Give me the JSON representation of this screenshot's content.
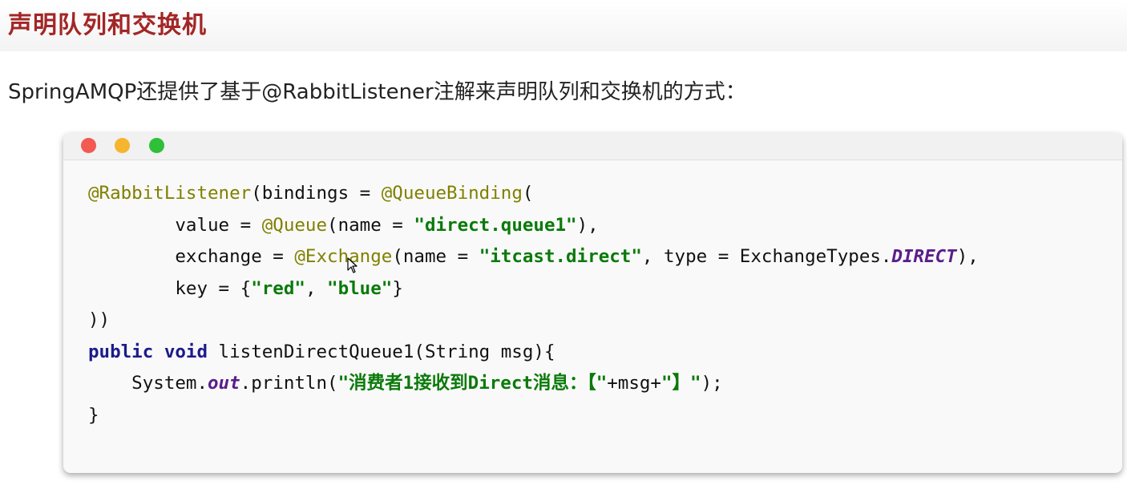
{
  "page": {
    "title": "声明队列和交换机",
    "intro": "SpringAMQP还提供了基于@RabbitListener注解来声明队列和交换机的方式："
  },
  "window": {
    "buttons": [
      "close",
      "minimize",
      "zoom"
    ],
    "colors": {
      "close": "#f25a52",
      "minimize": "#f5b52e",
      "zoom": "#2fbf39"
    }
  },
  "code": {
    "l1_ann1": "@RabbitListener",
    "l1_mid": "(bindings = ",
    "l1_ann2": "@QueueBinding",
    "l1_end": "(",
    "l2_pre": "        value = ",
    "l2_ann": "@Queue",
    "l2_mid": "(name = ",
    "l2_str": "\"direct.queue1\"",
    "l2_end": "),",
    "l3_pre": "        exchange = ",
    "l3_ann": "@Exchange",
    "l3_mid": "(name = ",
    "l3_str": "\"itcast.direct\"",
    "l3_mid2": ", type = ExchangeTypes.",
    "l3_const": "DIRECT",
    "l3_end": "),",
    "l4_pre": "        key = {",
    "l4_str1": "\"red\"",
    "l4_sep": ", ",
    "l4_str2": "\"blue\"",
    "l4_end": "}",
    "l5": "))",
    "l6_kw1": "public",
    "l6_sp": " ",
    "l6_kw2": "void",
    "l6_rest": " listenDirectQueue1(String msg){",
    "l7_pre": "    System.",
    "l7_out": "out",
    "l7_mid": ".println(",
    "l7_str1": "\"消费者1接收到Direct消息：【\"",
    "l7_plus": "+msg+",
    "l7_str2": "\"】\"",
    "l7_end": ");",
    "l8": "}"
  },
  "syntax_colors": {
    "annotation": "#808000",
    "string": "#0a7a0a",
    "keyword": "#1b1b8c",
    "static_field": "#5a1e8a",
    "title": "#a32626"
  },
  "icons": [
    "mouse-cursor-icon"
  ]
}
